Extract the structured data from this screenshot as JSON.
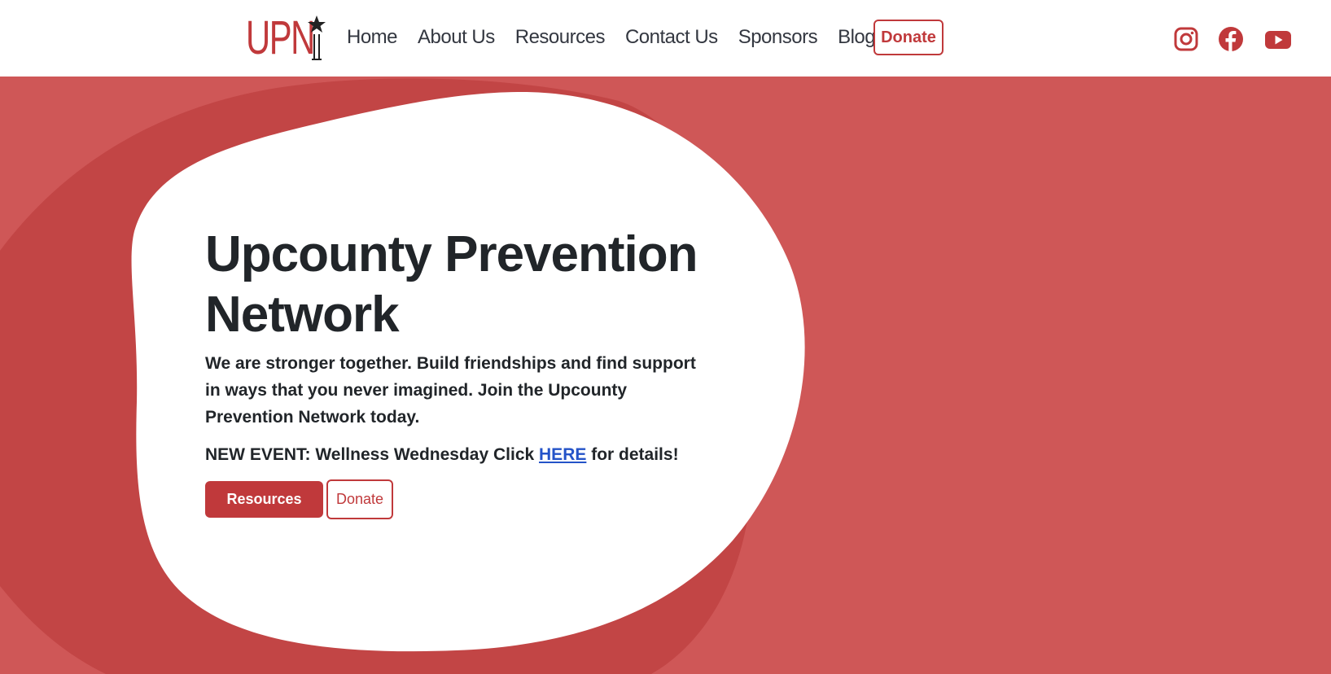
{
  "brand": {
    "logo_text": "UPN",
    "accent_color": "#c0393b",
    "background_color": "#cf5757"
  },
  "nav": {
    "links": [
      "Home",
      "About Us",
      "Resources",
      "Contact Us",
      "Sponsors",
      "Blog"
    ],
    "donate_label": "Donate"
  },
  "social": {
    "icons": [
      "instagram-icon",
      "facebook-icon",
      "youtube-icon"
    ]
  },
  "hero": {
    "title_line1": "Upcounty Prevention",
    "title_line2": "Network",
    "lead": "We are stronger together. Build friendships and find support in ways that you never imagined. Join the Upcounty Prevention Network today.",
    "event_prefix": "NEW EVENT: Wellness Wednesday Click ",
    "event_link": "HERE",
    "event_suffix": " for details!",
    "resources_button": "Resources",
    "donate_button": "Donate"
  }
}
